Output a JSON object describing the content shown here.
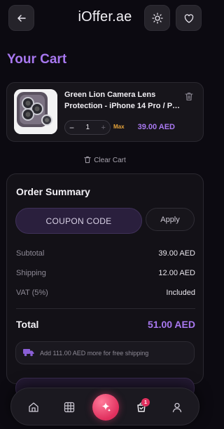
{
  "header": {
    "logo_text": "iOffer.ae",
    "back_icon": "arrow-left-icon",
    "theme_icon": "sun-icon",
    "wishlist_icon": "heart-icon"
  },
  "page_title": "Your Cart",
  "cart_items": [
    {
      "name_line1": "Green Lion Camera Lens",
      "name_line2": "Protection - iPhone 14 Pro / P…",
      "quantity": "1",
      "decrement": "−",
      "increment": "+",
      "max_label": "Max",
      "price": "39.00 AED"
    }
  ],
  "clear_cart_label": "Clear Cart",
  "summary": {
    "title": "Order Summary",
    "coupon_placeholder": "COUPON CODE",
    "apply_label": "Apply",
    "subtotal_label": "Subtotal",
    "subtotal_value": "39.00 AED",
    "shipping_label": "Shipping",
    "shipping_value": "12.00 AED",
    "vat_label": "VAT (5%)",
    "vat_value": "Included",
    "total_label": "Total",
    "total_value": "51.00 AED",
    "free_shipping_note": "Add 111.00 AED more for free shipping"
  },
  "bottom_nav": {
    "items": [
      "home-icon",
      "grid-icon",
      "sparkle-icon",
      "cart-icon",
      "user-icon"
    ],
    "cart_badge": "1"
  },
  "colors": {
    "accent": "#a878f0",
    "background": "#0c0a11",
    "warning": "#e8a53a",
    "fab": "#e0305e"
  }
}
